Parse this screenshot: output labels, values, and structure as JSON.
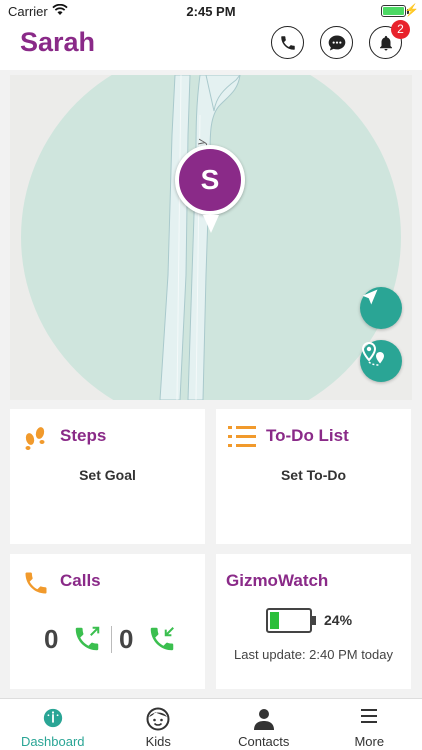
{
  "status_bar": {
    "carrier": "Carrier",
    "time": "2:45 PM"
  },
  "header": {
    "name": "Sarah",
    "notification_count": "2"
  },
  "map": {
    "pin_initial": "S",
    "road_label": "y"
  },
  "cards": {
    "steps": {
      "title": "Steps",
      "action": "Set Goal"
    },
    "todo": {
      "title": "To-Do List",
      "action": "Set To-Do"
    },
    "calls": {
      "title": "Calls",
      "outgoing": "0",
      "incoming": "0"
    },
    "gizmowatch": {
      "title": "GizmoWatch",
      "battery_pct": "24%",
      "battery_level": 0.24,
      "last_update": "Last update: 2:40 PM today"
    }
  },
  "tabs": [
    {
      "label": "Dashboard",
      "icon": "dashboard-icon",
      "active": true
    },
    {
      "label": "Kids",
      "icon": "kid-face-icon"
    },
    {
      "label": "Contacts",
      "icon": "person-icon"
    },
    {
      "label": "More",
      "icon": "hamburger-icon"
    }
  ],
  "colors": {
    "brand": "#8a2a88",
    "accent": "#2aa595",
    "alert": "#e8222b",
    "icon_orange": "#f19a2c"
  }
}
